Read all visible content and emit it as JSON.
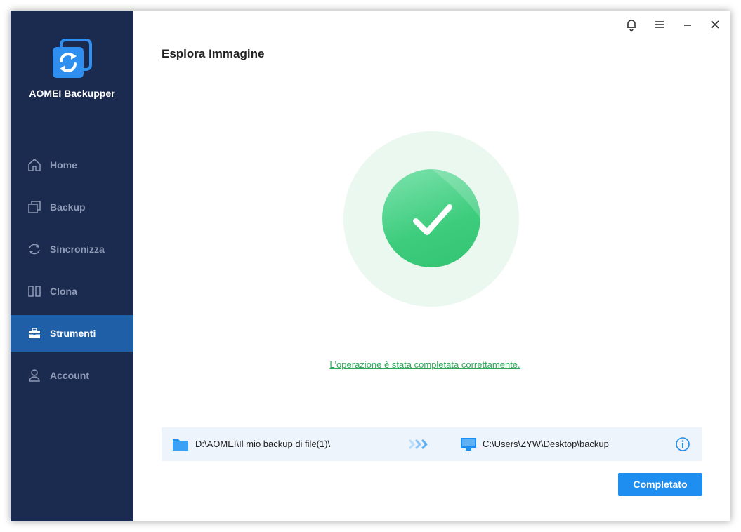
{
  "app": {
    "name": "AOMEI Backupper",
    "logo_icon": "aomei-logo-icon"
  },
  "titlebar": {
    "buttons": [
      {
        "name": "notifications",
        "icon": "bell-icon"
      },
      {
        "name": "menu",
        "icon": "menu-icon"
      },
      {
        "name": "minimize",
        "icon": "minimize-icon"
      },
      {
        "name": "close",
        "icon": "close-icon"
      }
    ]
  },
  "sidebar": {
    "items": [
      {
        "label": "Home",
        "icon": "home-icon",
        "active": false
      },
      {
        "label": "Backup",
        "icon": "backup-icon",
        "active": false
      },
      {
        "label": "Sincronizza",
        "icon": "sync-icon",
        "active": false
      },
      {
        "label": "Clona",
        "icon": "clone-icon",
        "active": false
      },
      {
        "label": "Strumenti",
        "icon": "toolbox-icon",
        "active": true
      },
      {
        "label": "Account",
        "icon": "user-icon",
        "active": false
      }
    ]
  },
  "main": {
    "title": "Esplora Immagine",
    "status_icon": "check-icon",
    "success_message": "L'operazione è stata completata correttamente.",
    "source_path": "D:\\AOMEI\\Il mio backup di file(1)\\",
    "destination_path": "C:\\Users\\ZYW\\Desktop\\backup",
    "done_label": "Completato"
  },
  "colors": {
    "sidebar_bg": "#1b2a4f",
    "sidebar_active": "#1f5fa8",
    "accent": "#1e8ef0",
    "success": "#3ccc7c",
    "success_text": "#2ea85a",
    "path_bar_bg": "#eef4fc"
  }
}
